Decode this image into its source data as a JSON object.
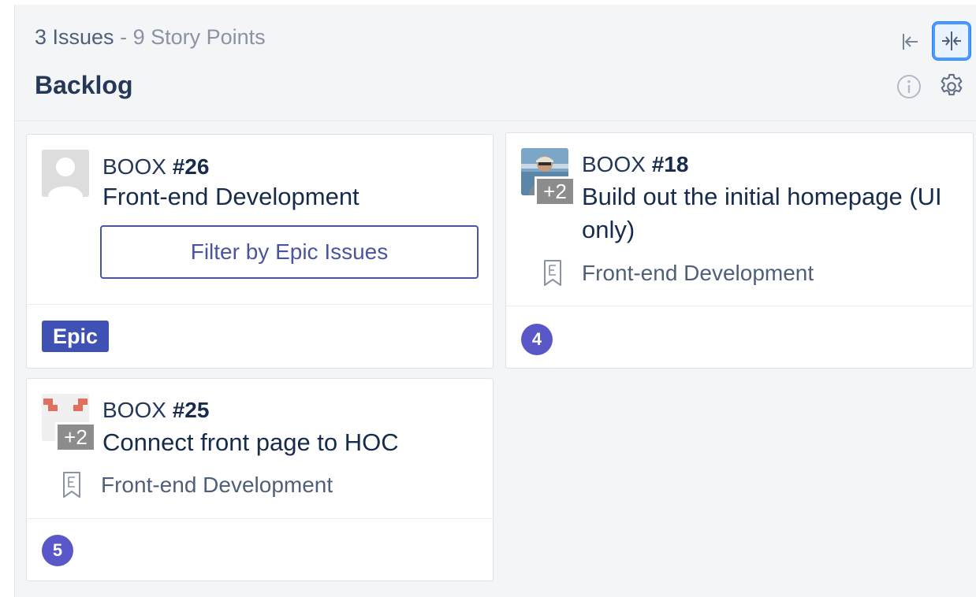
{
  "pipeline": {
    "issue_count": "3 Issues",
    "separator": "-",
    "story_points": "9 Story Points",
    "title": "Backlog"
  },
  "header_icons": {
    "collapse": "collapse-left-icon",
    "compact": "compact-view-icon",
    "info": "info-icon",
    "settings": "gear-icon"
  },
  "cards": [
    {
      "repo": "BOOX",
      "number": "#26",
      "title": "Front-end Development",
      "action_label": "Filter by Epic Issues",
      "label": "Epic",
      "avatar": "default-user-avatar"
    },
    {
      "repo": "BOOX",
      "number": "#18",
      "title": "Build out the initial homepage (UI only)",
      "extra_assignees": "+2",
      "epic": "Front-end Development",
      "estimate": "4",
      "avatar": "photo-avatar"
    },
    {
      "repo": "BOOX",
      "number": "#25",
      "title": "Connect front page to HOC",
      "extra_assignees": "+2",
      "epic": "Front-end Development",
      "estimate": "5",
      "avatar": "identicon-avatar"
    }
  ],
  "colors": {
    "epic_label": "#3f51b5",
    "estimate_badge": "#5a57c9",
    "filter_button": "#4a55a2",
    "focus_ring": "#4c9aff"
  }
}
